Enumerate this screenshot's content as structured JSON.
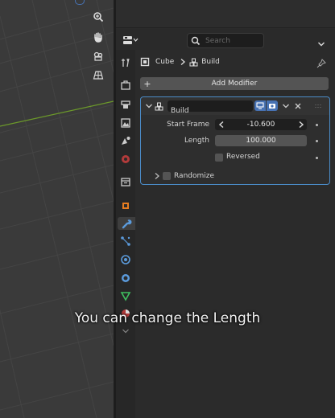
{
  "header": {
    "search_placeholder": "Search"
  },
  "breadcrumb": {
    "object": "Cube",
    "modifier": "Build"
  },
  "modifiers": {
    "add_label": "Add Modifier",
    "build": {
      "name": "Build",
      "start_frame_label": "Start Frame",
      "start_frame_value": "-10.600",
      "length_label": "Length",
      "length_value": "100.000",
      "reversed_label": "Reversed",
      "randomize_label": "Randomize"
    }
  },
  "caption": "You can change the Length",
  "colors": {
    "accent": "#4772b3",
    "panel_outline": "#4b8cc8",
    "grid_axis": "#6c9a2a"
  }
}
